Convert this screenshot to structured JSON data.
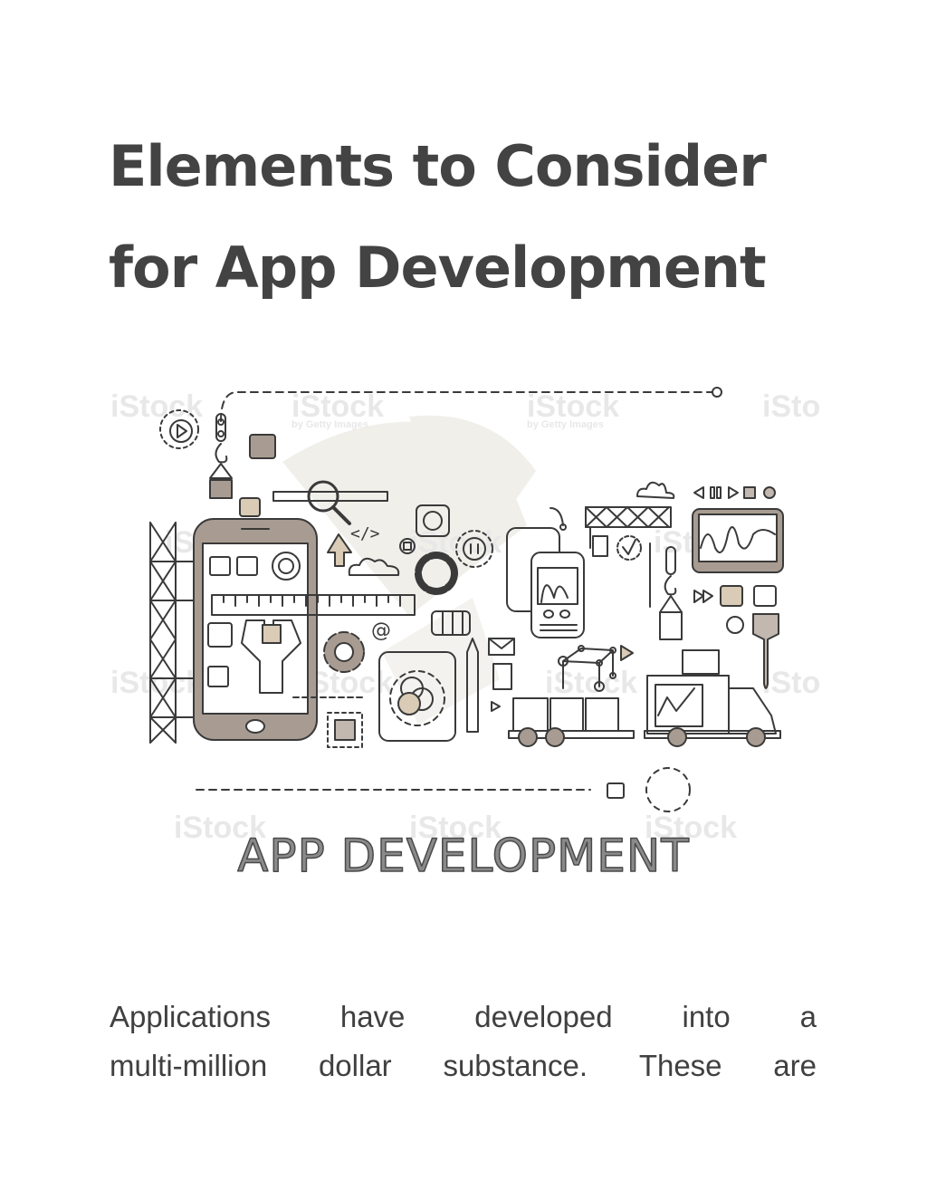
{
  "document": {
    "title_lines": [
      "Elements to Consider",
      "for App Development"
    ],
    "illustration": {
      "caption": "APP DEVELOPMENT",
      "watermark": "iStock",
      "watermark_sub": "by Getty Images",
      "colors": {
        "line": "#3a3a3a",
        "fill_taupe": "#a89c92",
        "fill_beige": "#d9cbb5",
        "fill_gray": "#c2b8b0",
        "background_shape": "#f0efea"
      }
    },
    "paragraph_lines": [
      [
        "Applications",
        "have",
        "developed",
        "into",
        "a"
      ],
      [
        "multi-million",
        "dollar",
        "substance.",
        "These",
        "are"
      ]
    ]
  }
}
